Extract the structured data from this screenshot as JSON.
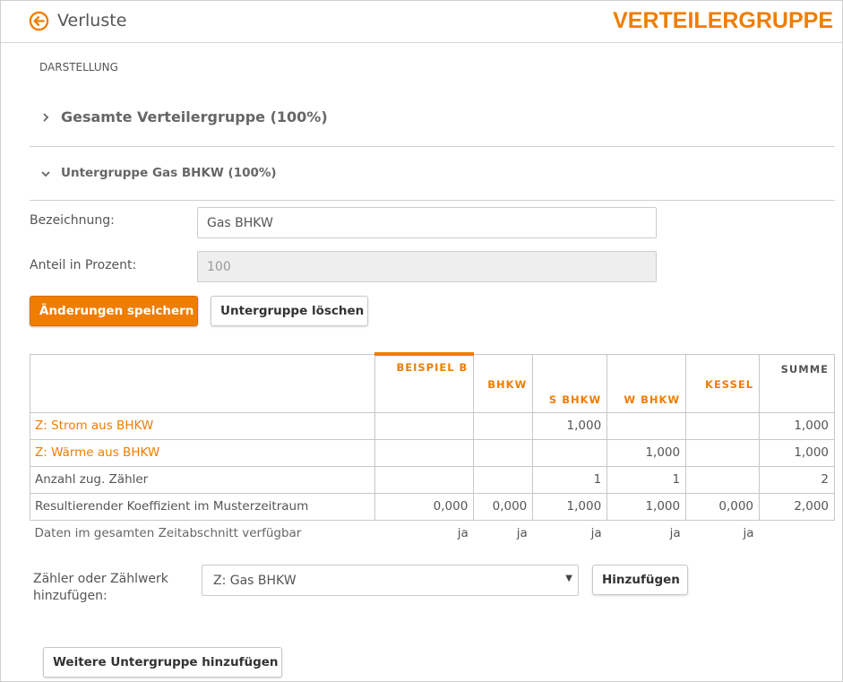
{
  "header": {
    "back_label": "Verluste",
    "app_title": "VERTEILERGRUPPE",
    "accent_color": "#ef7d00",
    "back_icon": "back-arrow-circle-icon"
  },
  "section_label": "DARSTELLUNG",
  "accordion": [
    {
      "label": "Gesamte Verteilergruppe (100%)",
      "expanded": false
    },
    {
      "label": "Untergruppe Gas BHKW (100%)",
      "expanded": true
    }
  ],
  "form": {
    "name_label": "Bezeichnung:",
    "name_value": "Gas BHKW",
    "share_label": "Anteil in Prozent:",
    "share_value": "100",
    "save_label": "Änderungen speichern",
    "delete_label": "Untergruppe löschen"
  },
  "table": {
    "columns": [
      "BEISPIEL B",
      "BHKW",
      "S BHKW",
      "W BHKW",
      "KESSEL",
      "SUMME"
    ],
    "rows": [
      {
        "label": "Z: Strom aus BHKW",
        "cells": [
          "",
          "",
          "1,000",
          "",
          "",
          "1,000"
        ]
      },
      {
        "label": "Z: Wärme aus BHKW",
        "cells": [
          "",
          "",
          "",
          "1,000",
          "",
          "1,000"
        ]
      },
      {
        "label": "Anzahl zug. Zähler",
        "cells": [
          "",
          "",
          "1",
          "1",
          "",
          "2"
        ]
      },
      {
        "label": "Resultierender Koeffizient im Musterzeitraum",
        "cells": [
          "0,000",
          "0,000",
          "1,000",
          "1,000",
          "0,000",
          "2,000"
        ]
      }
    ],
    "footer": {
      "label": "Daten im gesamten Zeitabschnitt verfügbar",
      "cells": [
        "ja",
        "ja",
        "ja",
        "ja",
        "ja",
        ""
      ]
    }
  },
  "add_meter": {
    "label": "Zähler oder Zählwerk hinzufügen:",
    "selected": "Z: Gas BHKW",
    "button_label": "Hinzufügen"
  },
  "add_subgroup_label": "Weitere Untergruppe hinzufügen"
}
